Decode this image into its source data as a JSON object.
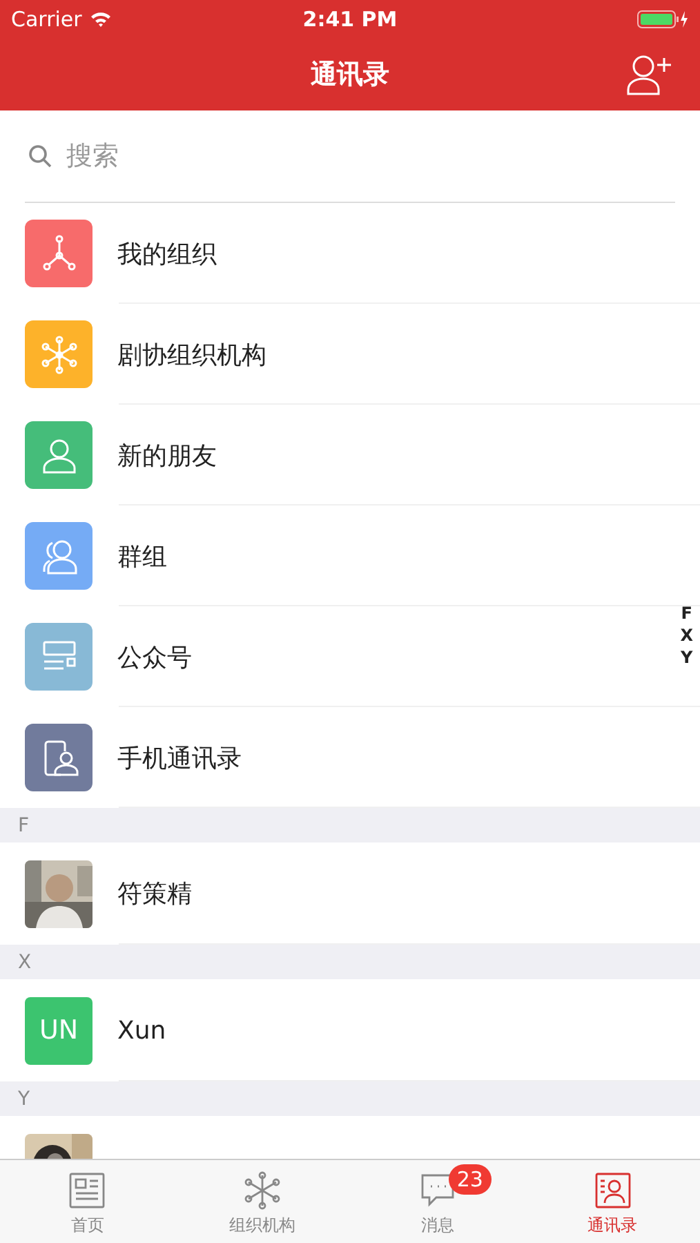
{
  "status_bar": {
    "carrier": "Carrier",
    "time": "2:41 PM"
  },
  "nav": {
    "title": "通讯录"
  },
  "search": {
    "placeholder": "搜索"
  },
  "shortcuts": [
    {
      "label": "我的组织",
      "kind": "org",
      "color": "#f76b6b"
    },
    {
      "label": "剧协组织机构",
      "kind": "network",
      "color": "#fdb22a"
    },
    {
      "label": "新的朋友",
      "kind": "friend",
      "color": "#45bd7a"
    },
    {
      "label": "群组",
      "kind": "group",
      "color": "#75abf5"
    },
    {
      "label": "公众号",
      "kind": "official",
      "color": "#88b9d6"
    },
    {
      "label": "手机通讯录",
      "kind": "phone",
      "color": "#717b9c"
    }
  ],
  "sections": [
    {
      "letter": "F",
      "contacts": [
        {
          "name": "符策精"
        }
      ]
    },
    {
      "letter": "X",
      "contacts": [
        {
          "name": "Xun",
          "avatar": {
            "kind": "initials",
            "text": "UN",
            "color": "#3cc46f"
          }
        }
      ]
    },
    {
      "letter": "Y"
    }
  ],
  "index": [
    "F",
    "X",
    "Y"
  ],
  "tabs": [
    {
      "label": "首页",
      "kind": "home",
      "selected": false
    },
    {
      "label": "组织机构",
      "kind": "network",
      "selected": false
    },
    {
      "label": "消息",
      "kind": "chat",
      "selected": false,
      "badge": "23"
    },
    {
      "label": "通讯录",
      "kind": "contacts",
      "selected": true
    }
  ]
}
